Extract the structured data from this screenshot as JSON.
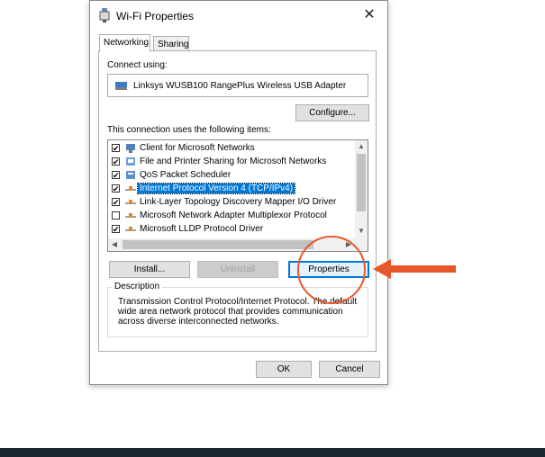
{
  "window": {
    "title": "Wi-Fi Properties",
    "close_glyph": "✕"
  },
  "tabs": [
    {
      "label": "Networking",
      "active": true
    },
    {
      "label": "Sharing",
      "active": false
    }
  ],
  "connect": {
    "label": "Connect using:",
    "adapter_name": "Linksys WUSB100 RangePlus Wireless USB Adapter",
    "adapter_icon": "network-adapter-icon",
    "configure_button": "Configure..."
  },
  "items_section": {
    "label": "This connection uses the following items:",
    "items": [
      {
        "label": "Client for Microsoft Networks",
        "checked": true,
        "icon": "client-icon",
        "selected": false
      },
      {
        "label": "File and Printer Sharing for Microsoft Networks",
        "checked": true,
        "icon": "file-sharing-icon",
        "selected": false
      },
      {
        "label": "QoS Packet Scheduler",
        "checked": true,
        "icon": "qos-icon",
        "selected": false
      },
      {
        "label": "Internet Protocol Version 4 (TCP/IPv4)",
        "checked": true,
        "icon": "protocol-icon",
        "selected": true
      },
      {
        "label": "Link-Layer Topology Discovery Mapper I/O Driver",
        "checked": true,
        "icon": "protocol-icon",
        "selected": false
      },
      {
        "label": "Microsoft Network Adapter Multiplexor Protocol",
        "checked": false,
        "icon": "protocol-icon",
        "selected": false
      },
      {
        "label": "Microsoft LLDP Protocol Driver",
        "checked": true,
        "icon": "protocol-icon",
        "selected": false
      }
    ]
  },
  "actions": {
    "install": "Install...",
    "uninstall": "Uninstall",
    "properties": "Properties"
  },
  "description": {
    "title": "Description",
    "text": "Transmission Control Protocol/Internet Protocol. The default wide area network protocol that provides communication across diverse interconnected networks."
  },
  "footer": {
    "ok": "OK",
    "cancel": "Cancel"
  },
  "colors": {
    "accent": "#0078d7",
    "annotation": "#e8572a",
    "bottom_bar": "#1c2532"
  }
}
